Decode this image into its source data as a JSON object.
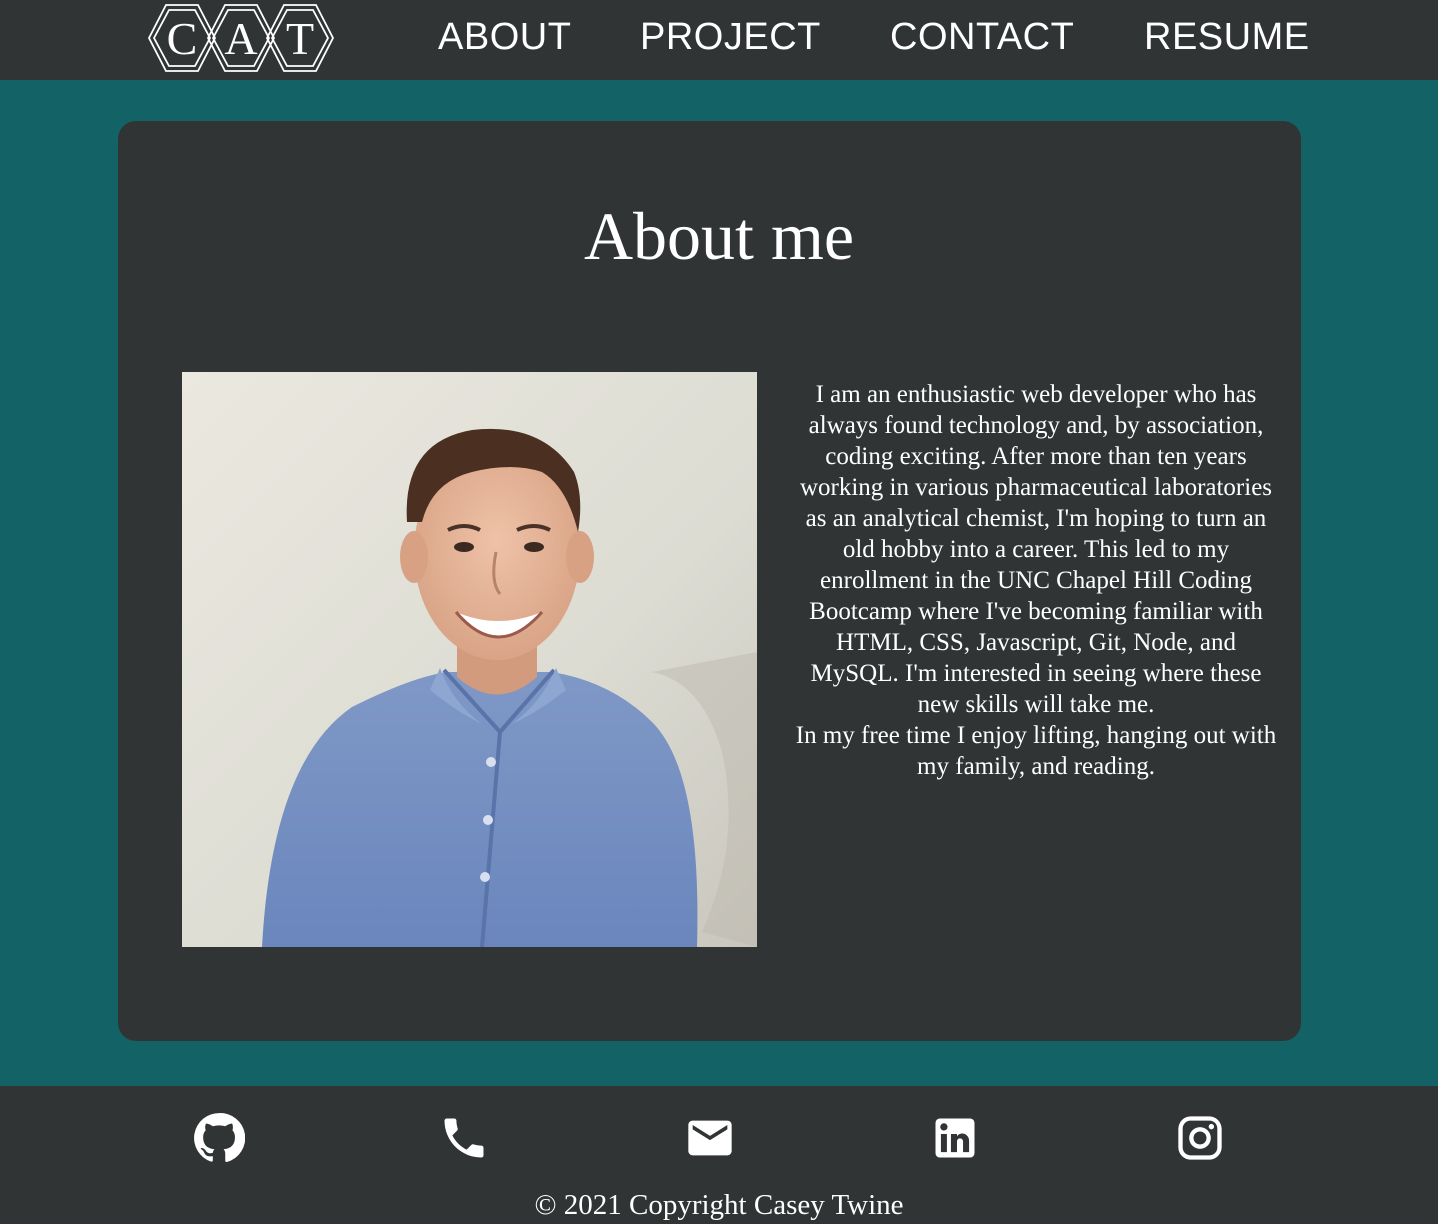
{
  "header": {
    "logo_letters": [
      "C",
      "A",
      "T"
    ],
    "nav": [
      {
        "label": "ABOUT"
      },
      {
        "label": "PROJECT"
      },
      {
        "label": "CONTACT"
      },
      {
        "label": "RESUME"
      }
    ]
  },
  "about": {
    "title": "About me",
    "bio_paragraph_1": "I am an enthusiastic web developer who has always found technology and, by association, coding exciting. After more than ten years working in various pharmaceutical laboratories as an analytical chemist, I'm hoping to turn an old hobby into a career. This led to my enrollment in the UNC Chapel Hill Coding Bootcamp where I've becoming familiar with HTML, CSS, Javascript, Git, Node, and MySQL. I'm interested in seeing where these new skills will take me.",
    "bio_paragraph_2": "In my free time I enjoy lifting, hanging out with my family, and reading."
  },
  "footer": {
    "social_icons": [
      "github-icon",
      "phone-icon",
      "email-icon",
      "linkedin-icon",
      "instagram-icon"
    ],
    "copyright": "© 2021 Copyright Casey Twine"
  },
  "colors": {
    "background": "#136266",
    "panel": "#303434",
    "text": "#ffffff"
  }
}
